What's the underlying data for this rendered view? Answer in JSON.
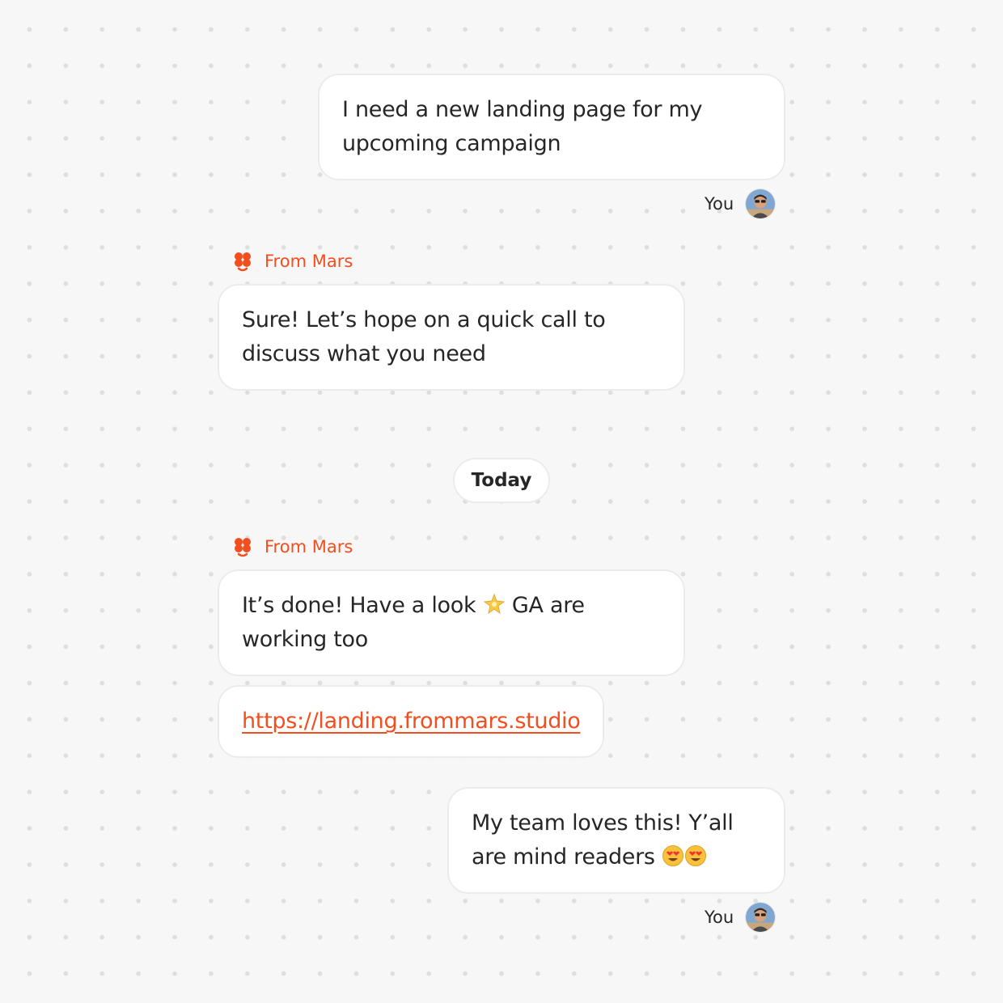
{
  "messages": [
    {
      "from": "You",
      "text": "I need a new landing page for my upcoming campaign"
    },
    {
      "from": "From Mars",
      "text": "Sure! Let’s hope on a quick call to discuss what you need"
    },
    {
      "from": "From Mars",
      "text_before": "It’s done! Have a look",
      "emoji": "sparkle-star",
      "text_after": "GA are working too"
    },
    {
      "from": "From Mars",
      "link": "https://landing.frommars.studio"
    },
    {
      "from": "You",
      "text": "My team loves this! Y’all are mind readers",
      "emoji": "heart-eyes-face x2"
    }
  ],
  "labels": {
    "you": "You",
    "mars": "From Mars"
  },
  "date_separator": "Today",
  "icons": {
    "mars_logo": "flower-logo-icon",
    "avatar": "user-avatar"
  },
  "colors": {
    "accent": "#f24e1e",
    "bubble_bg": "#ffffff",
    "bubble_border": "#ebebeb",
    "page_bg": "#f7f7f7",
    "text": "#262626"
  }
}
